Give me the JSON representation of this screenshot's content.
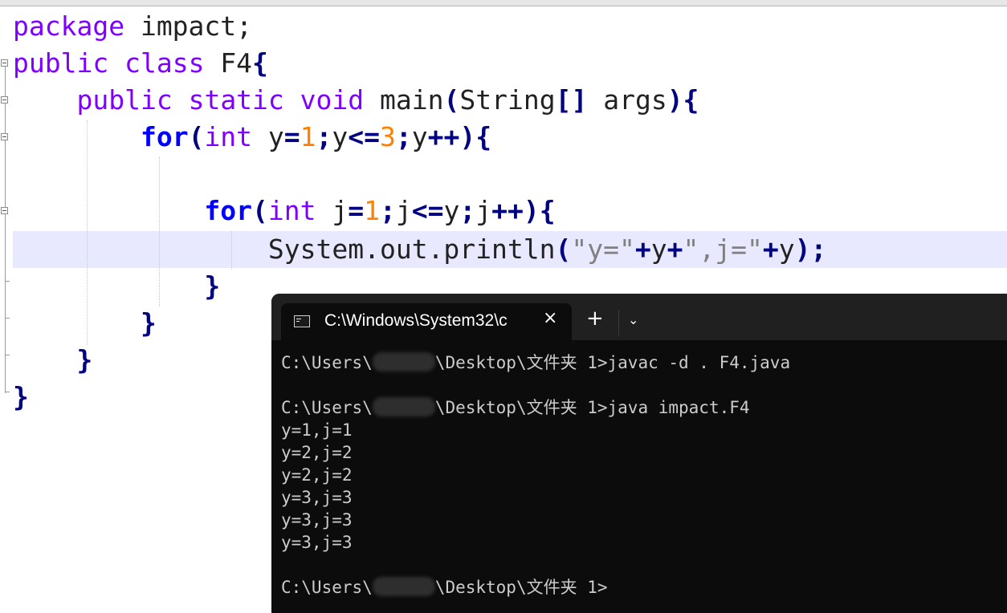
{
  "editor": {
    "line1": {
      "kw": "package",
      "rest": " impact;"
    },
    "line2": {
      "kw1": "public",
      "kw2": "class",
      "rest": " F4",
      "brace": "{"
    },
    "line3": {
      "kw1": "public",
      "kw2": "static",
      "kw3": "void",
      "name": " main",
      "paren": "(",
      "type": "String",
      "brackets": "[]",
      "arg": " args",
      "close": "){"
    },
    "line4": {
      "kw": "for",
      "open": "(",
      "type": "int",
      "var": " y",
      "eq": "=",
      "n1": "1",
      "semi1": ";",
      "v2": "y",
      "le": "<=",
      "n2": "3",
      "semi2": ";",
      "v3": "y",
      "inc": "++){"
    },
    "line6": {
      "kw": "for",
      "open": "(",
      "type": "int",
      "var": " j",
      "eq": "=",
      "n1": "1",
      "semi1": ";",
      "v2": "j",
      "le": "<=",
      "v4": "y",
      "semi2": ";",
      "v3": "j",
      "inc": "++){"
    },
    "line7": {
      "obj": "System.out.println",
      "open": "(",
      "s1": "\"y=\"",
      "plus1": "+",
      "v1": "y",
      "plus2": "+",
      "s2": "\",j=\"",
      "plus3": "+",
      "v2": "y",
      "close": ");"
    },
    "close_inner": "}",
    "close_outer_for": "}",
    "close_main": "}",
    "close_class": "}"
  },
  "terminal": {
    "tab_title": "C:\\Windows\\System32\\c",
    "close_icon": "×",
    "new_tab_icon": "+",
    "dropdown_icon": "⌄",
    "lines": {
      "cmd1_prefix": "C:\\Users\\",
      "cmd1_suffix": "\\Desktop\\文件夹 1>javac -d . F4.java",
      "cmd2_prefix": "C:\\Users\\",
      "cmd2_suffix": "\\Desktop\\文件夹 1>java impact.F4",
      "out1": "y=1,j=1",
      "out2": "y=2,j=2",
      "out3": "y=2,j=2",
      "out4": "y=3,j=3",
      "out5": "y=3,j=3",
      "out6": "y=3,j=3",
      "prompt_prefix": "C:\\Users\\",
      "prompt_suffix": "\\Desktop\\文件夹 1>"
    }
  },
  "colors": {
    "keyword": "#8000ff",
    "control": "#0000ff",
    "number": "#ff8000",
    "operator": "#000080",
    "string": "#808080",
    "current_line": "#e8e8ff",
    "terminal_bg": "#0c0c0c"
  }
}
